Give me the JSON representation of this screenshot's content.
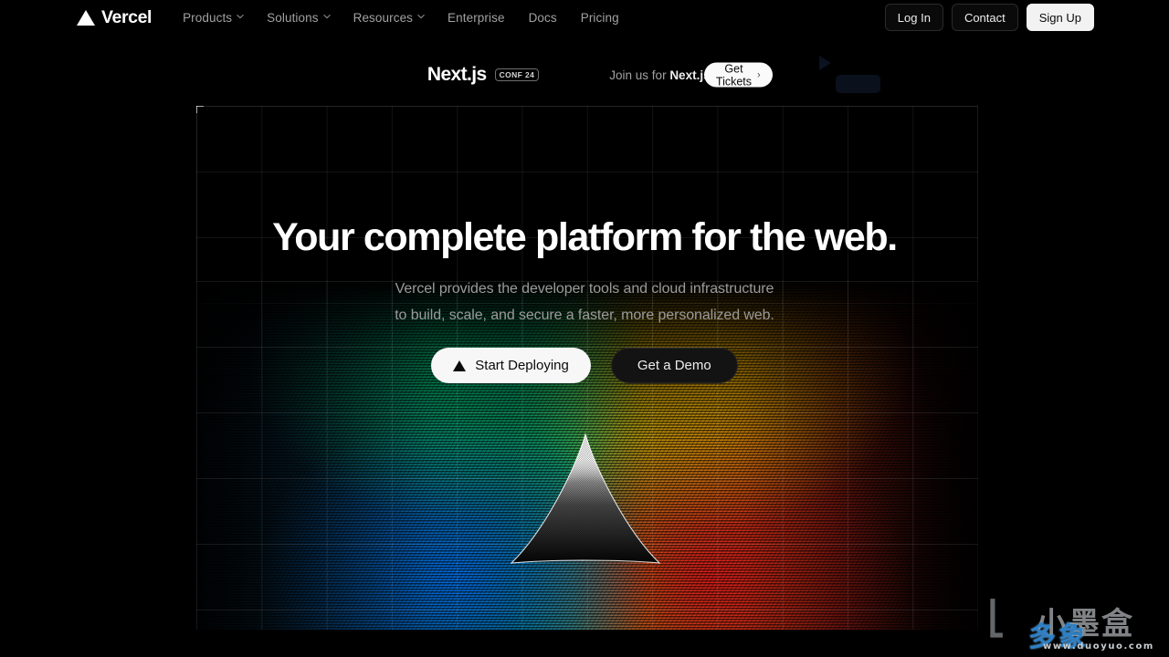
{
  "header": {
    "brand": {
      "name": "Vercel",
      "logo_icon": "vercel-triangle-icon"
    },
    "nav": [
      {
        "label": "Products",
        "has_dropdown": true
      },
      {
        "label": "Solutions",
        "has_dropdown": true
      },
      {
        "label": "Resources",
        "has_dropdown": true
      },
      {
        "label": "Enterprise",
        "has_dropdown": false
      },
      {
        "label": "Docs",
        "has_dropdown": false
      },
      {
        "label": "Pricing",
        "has_dropdown": false
      }
    ],
    "actions": {
      "login": "Log In",
      "contact": "Contact",
      "signup": "Sign Up"
    }
  },
  "banner": {
    "logo": "Next.js",
    "badge": "CONF 24",
    "message_prefix": "Join us for ",
    "message_bold": "Next.js Conf",
    "cta_label": "Get Tickets",
    "cta_arrow": "›"
  },
  "hero": {
    "headline": "Your complete platform for the web.",
    "subtitle_line1": "Vercel provides the developer tools and cloud infrastructure",
    "subtitle_line2": "to build, scale, and secure a faster, more personalized web.",
    "primary_cta": "Start Deploying",
    "primary_cta_icon": "vercel-triangle-icon",
    "secondary_cta": "Get a Demo"
  },
  "watermark": {
    "mark": "小墨盒",
    "brand_cn": "多象",
    "url": "www.duoyuo.com"
  },
  "colors": {
    "page_background": "#000000",
    "text_primary": "#ededed",
    "text_muted": "#a1a1a1",
    "accent_white": "#fafafa",
    "gradient_green": "#1aa05e",
    "gradient_yellow": "#f0b400",
    "gradient_blue": "#006eeb",
    "gradient_red": "#e11919"
  }
}
